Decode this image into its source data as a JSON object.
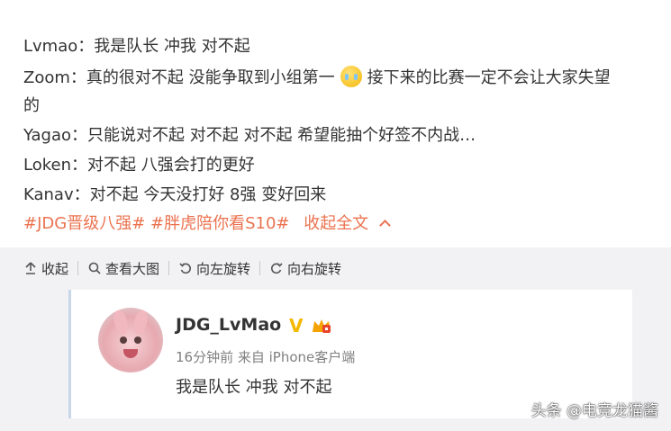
{
  "post": {
    "lines": [
      "Lvmao：我是队长 冲我 对不起",
      "Zoom：真的很对不起 没能争取到小组第一",
      "接下来的比赛一定不会让大家失望",
      "的",
      "Yagao：只能说对不起 对不起 对不起 希望能抽个好签不内战…",
      "Loken：对不起 八强会打的更好",
      "Kanav：对不起 今天没打好 8强 变好回来"
    ],
    "emoji": "crying-face-emoji",
    "tags": [
      "#JDG晋级八强#",
      "#胖虎陪你看S10#"
    ],
    "collapse_link": "收起全文"
  },
  "toolbar": {
    "collapse": "收起",
    "view_large": "查看大图",
    "rotate_left": "向左旋转",
    "rotate_right": "向右旋转"
  },
  "card": {
    "username": "JDG_LvMao",
    "verified_badge": "V",
    "meta": "16分钟前 来自 iPhone客户端",
    "text": "我是队长 冲我 对不起"
  },
  "watermark": "头条 @电竞龙猫酱",
  "colors": {
    "link": "#eb7350",
    "text": "#333333",
    "media_bg": "#f2f2f5",
    "card_border": "#c8d7ea",
    "verified": "#f5b800"
  }
}
